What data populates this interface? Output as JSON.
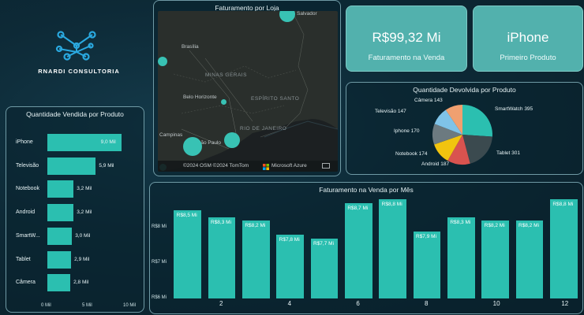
{
  "brand": {
    "name": "RNARDI CONSULTORIA"
  },
  "map": {
    "title": "Faturamento por Loja",
    "labels": [
      "Brasília",
      "MINAS GERAIS",
      "Belo Horizonte",
      "Belo Horizonte",
      "ESPÍRITO SANTO",
      "RIO DE JANEIRO",
      "Campinas",
      "São Paulo",
      "Salvador"
    ],
    "footer_copyright": "©2024 OSM ©2024 TomTom",
    "footer_brand": "Microsoft Azure"
  },
  "kpi": [
    {
      "value": "R$99,32 Mi",
      "label": "Faturamento na Venda"
    },
    {
      "value": "iPhone",
      "label": "Primeiro Produto"
    }
  ],
  "colors": {
    "teal": "#2bbfb0",
    "card": "#52b1ad"
  },
  "chart_data": [
    {
      "type": "bar",
      "orientation": "horizontal",
      "title": "Quantidade Vendida por Produto",
      "categories": [
        "iPhone",
        "Televisão",
        "Notebook",
        "Android",
        "SmartW...",
        "Tablet",
        "Câmera"
      ],
      "values": [
        9.0,
        5.9,
        3.2,
        3.2,
        3.0,
        2.9,
        2.8
      ],
      "labels": [
        "9,0 Mil",
        "5,9 Mil",
        "3,2 Mil",
        "3,2 Mil",
        "3,0 Mil",
        "2,9 Mil",
        "2,8 Mil"
      ],
      "xlim": [
        0,
        10
      ],
      "xticks": [
        "0 Mil",
        "5 Mil",
        "10 Mil"
      ]
    },
    {
      "type": "pie",
      "title": "Quantidade Devolvida por Produto",
      "slices": [
        {
          "name": "SmartWatch",
          "value": 395,
          "color": "#2bbfb0"
        },
        {
          "name": "Tablet",
          "value": 301,
          "color": "#3b4a4f"
        },
        {
          "name": "Android",
          "value": 187,
          "color": "#d9534f"
        },
        {
          "name": "Notebook",
          "value": 174,
          "color": "#f1c40f"
        },
        {
          "name": "Iphone",
          "value": 170,
          "color": "#6c7a80"
        },
        {
          "name": "Televisão",
          "value": 147,
          "color": "#7fc3e8"
        },
        {
          "name": "Câmera",
          "value": 143,
          "color": "#f0a070"
        }
      ],
      "labels": [
        "SmartWatch 395",
        "Tablet 301",
        "Android 187",
        "Notebook 174",
        "Iphone 170",
        "Televisão 147",
        "Câmera 143"
      ]
    },
    {
      "type": "bar",
      "title": "Faturamento na Venda por Mês",
      "categories": [
        1,
        2,
        3,
        4,
        5,
        6,
        7,
        8,
        9,
        10,
        11,
        12
      ],
      "values": [
        8.5,
        8.3,
        8.2,
        7.8,
        7.7,
        8.7,
        8.8,
        7.9,
        8.3,
        8.2,
        8.2,
        8.8
      ],
      "labels": [
        "R$8,5 Mi",
        "R$8,3 Mi",
        "R$8,2 Mi",
        "R$7,8 Mi",
        "R$7,7 Mi",
        "R$8,7 Mi",
        "R$8,8 Mi",
        "R$7,9 Mi",
        "R$8,3 Mi",
        "R$8,2 Mi",
        "R$8,2 Mi",
        "R$8,8 Mi"
      ],
      "ylim": [
        6,
        9
      ],
      "yticks": [
        "R$6 Mi",
        "R$7 Mi",
        "R$8 Mi"
      ],
      "xticks": [
        "2",
        "4",
        "6",
        "8",
        "10",
        "12"
      ]
    }
  ]
}
